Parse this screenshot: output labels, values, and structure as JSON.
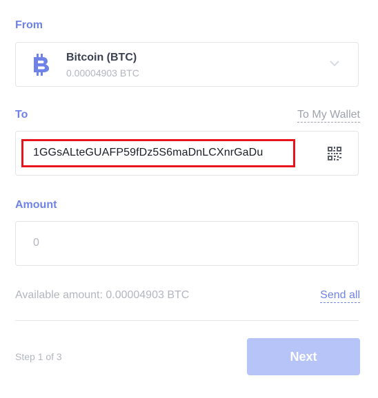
{
  "from": {
    "label": "From",
    "coin_name": "Bitcoin (BTC)",
    "coin_balance": "0.00004903 BTC",
    "icon": "bitcoin-icon"
  },
  "to": {
    "label": "To",
    "to_my_wallet": "To My Wallet",
    "address": "1GGsALteGUAFP59fDz5S6maDnLCXnrGaDu",
    "qr_icon": "qr-code-icon"
  },
  "amount": {
    "label": "Amount",
    "placeholder": "0"
  },
  "available": {
    "text": "Available amount: 0.00004903 BTC",
    "send_all": "Send all"
  },
  "footer": {
    "step": "Step 1 of 3",
    "next": "Next"
  },
  "colors": {
    "accent": "#6f82e8",
    "button_disabled": "#b6c4f7",
    "highlight": "#e8141c"
  }
}
